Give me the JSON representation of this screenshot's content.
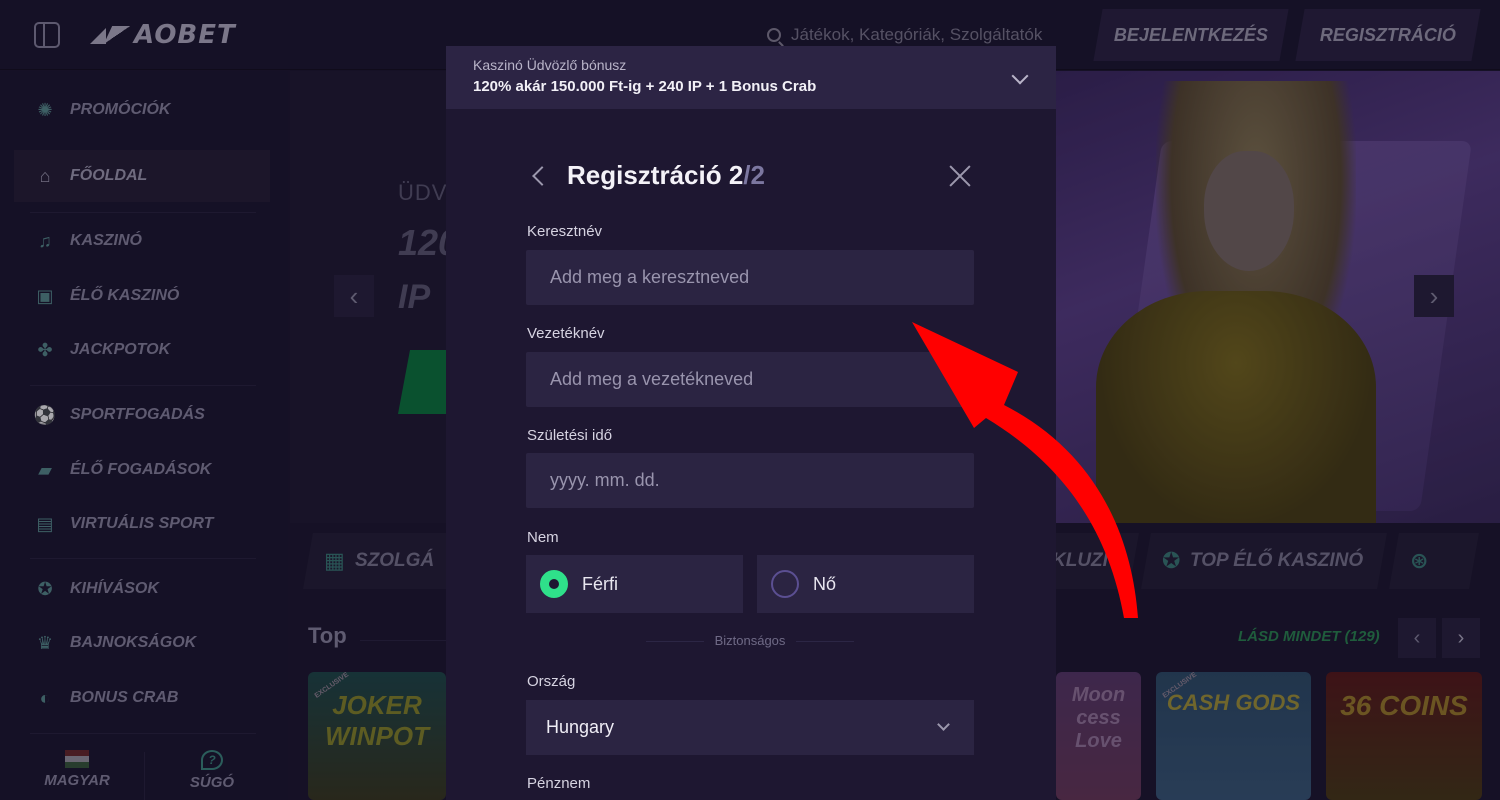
{
  "header": {
    "logo_text": "AOBET",
    "search_placeholder": "Játékok, Kategóriák, Szolgáltatók",
    "login_label": "BEJELENTKEZÉS",
    "register_label": "REGISZTRÁCIÓ"
  },
  "sidebar": {
    "items": [
      {
        "label": "PROMÓCIÓK",
        "icon": "promo-icon"
      },
      {
        "label": "FŐOLDAL",
        "icon": "home-icon"
      },
      {
        "label": "KASZINÓ",
        "icon": "casino-icon"
      },
      {
        "label": "ÉLŐ KASZINÓ",
        "icon": "live-casino-icon"
      },
      {
        "label": "JACKPOTOK",
        "icon": "clover-icon"
      },
      {
        "label": "SPORTFOGADÁS",
        "icon": "sports-icon"
      },
      {
        "label": "ÉLŐ FOGADÁSOK",
        "icon": "live-icon"
      },
      {
        "label": "VIRTUÁLIS SPORT",
        "icon": "virtual-sport-icon"
      },
      {
        "label": "KIHÍVÁSOK",
        "icon": "challenge-icon"
      },
      {
        "label": "BAJNOKSÁGOK",
        "icon": "trophy-icon"
      },
      {
        "label": "BONUS CRAB",
        "icon": "crab-icon"
      }
    ],
    "language_label": "MAGYAR",
    "help_label": "SÚGÓ"
  },
  "hero": {
    "text_1": "ÜDV",
    "text_2": "120",
    "text_3": "IP"
  },
  "categories": {
    "left": "SZOLGÁ",
    "mid": "KLUZÍV",
    "top_live": "TOP ÉLŐ KASZINÓ"
  },
  "top_games": {
    "title": "Top",
    "see_all": "LÁSD MINDET (129)",
    "games": [
      {
        "title": "JOKER WINPOT",
        "badge": "EXCLUSIVE"
      },
      {
        "title": "Moon cess Love",
        "badge": ""
      },
      {
        "title": "CASH GODS",
        "badge": "EXCLUSIVE"
      },
      {
        "title": "36 COINS",
        "badge": ""
      }
    ]
  },
  "bonus": {
    "label": "Kaszinó Üdvözlő bónusz",
    "value": "120% akár 150.000 Ft-ig + 240 IP + 1 Bonus Crab"
  },
  "modal": {
    "title": "Regisztráció 2",
    "step_total": "/2",
    "first_name_label": "Keresztnév",
    "first_name_placeholder": "Add meg a keresztneved",
    "last_name_label": "Vezetéknév",
    "last_name_placeholder": "Add meg a vezetékneved",
    "birth_label": "Születési idő",
    "birth_placeholder": "yyyy. mm. dd.",
    "gender_label": "Nem",
    "gender_male": "Férfi",
    "gender_female": "Nő",
    "gender_selected": "Férfi",
    "secure_text": "Biztonságos",
    "country_label": "Ország",
    "country_value": "Hungary",
    "currency_label": "Pénznem"
  },
  "colors": {
    "accent_green": "#2fe08a",
    "annotation_red": "#ff0000",
    "background": "#1e1830"
  }
}
